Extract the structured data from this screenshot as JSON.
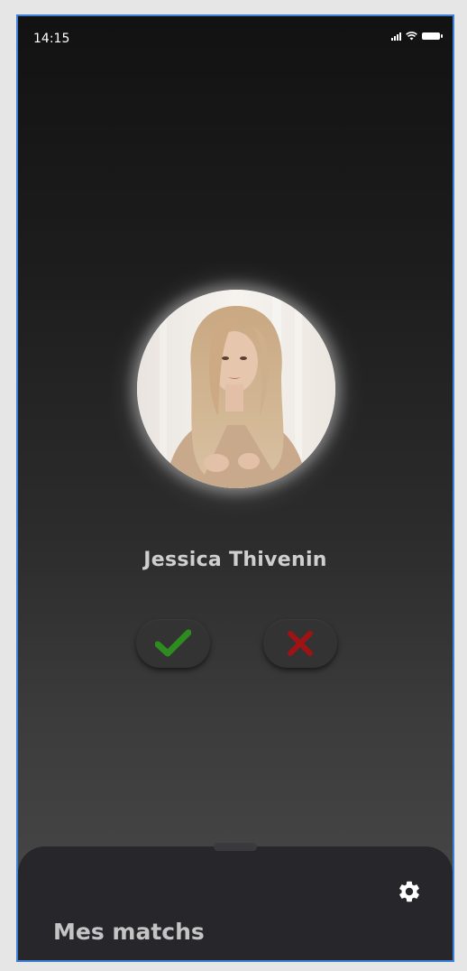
{
  "status_bar": {
    "time": "14:15",
    "icons": [
      "signal-icon",
      "wifi-icon",
      "battery-icon"
    ]
  },
  "profile": {
    "name": "Jessica Thivenin",
    "photo_icon": "profile-photo"
  },
  "actions": {
    "accept_icon": "check-icon",
    "reject_icon": "close-icon",
    "accept_color": "#2e8b1f",
    "reject_color": "#9e1414"
  },
  "bottom_sheet": {
    "title": "Mes matchs",
    "settings_icon": "gear-icon"
  }
}
